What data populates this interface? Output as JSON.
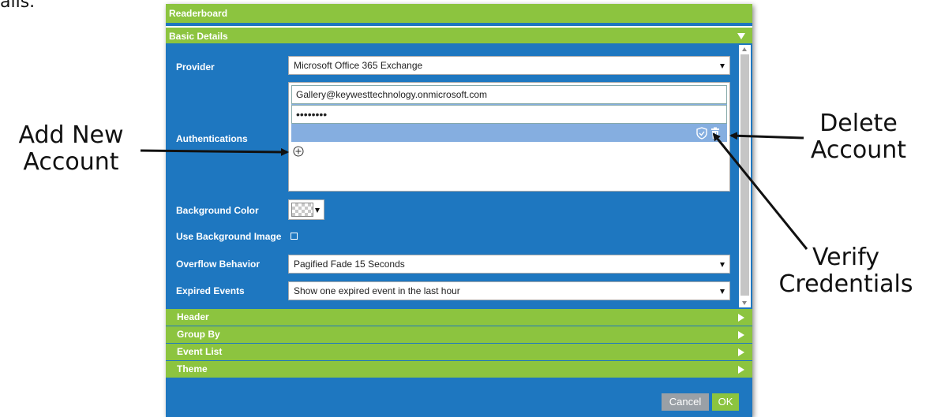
{
  "clipped_top_text": "ails.",
  "dialog": {
    "title": "Readerboard",
    "basic_section_label": "Basic Details",
    "fields": {
      "provider_label": "Provider",
      "provider_value": "Microsoft Office 365 Exchange",
      "authentications_label": "Authentications",
      "auth_email": "Gallery@keywesttechnology.onmicrosoft.com",
      "auth_password": "••••••••",
      "background_color_label": "Background Color",
      "use_background_image_label": "Use Background Image",
      "overflow_label": "Overflow Behavior",
      "overflow_value": "Pagified Fade 15 Seconds",
      "expired_label": "Expired Events",
      "expired_value": "Show one expired event in the last hour"
    },
    "collapsed_sections": [
      "Header",
      "Group By",
      "Event List",
      "Theme"
    ],
    "buttons": {
      "cancel": "Cancel",
      "ok": "OK"
    }
  },
  "annotations": {
    "add_new_account": "Add New\nAccount",
    "delete_account": "Delete\nAccount",
    "verify_credentials": "Verify\nCredentials"
  },
  "icons": {
    "verify": "shield-check-icon",
    "delete": "trash-icon",
    "add": "circle-plus-icon"
  },
  "colors": {
    "green": "#8cc43f",
    "blue": "#1e77c0",
    "auth_row": "#85aee0",
    "cancel": "#9aa0a6"
  }
}
